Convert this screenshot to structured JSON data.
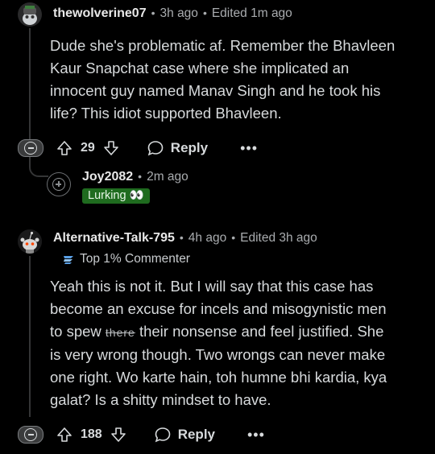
{
  "comments": [
    {
      "username": "thewolverine07",
      "time": "3h ago",
      "edited": "Edited 1m ago",
      "body": [
        "Dude she's problematic af. Remember the Bhavleen",
        "Kaur Snapchat case where she implicated an",
        "innocent guy named Manav Singh and he took his",
        "life? This idiot supported Bhavleen."
      ],
      "votes": "29",
      "reply_label": "Reply",
      "more_label": "•••"
    },
    {
      "username": "Joy2082",
      "time": "2m ago",
      "flair": "Lurking 👀"
    },
    {
      "username": "Alternative-Talk-795",
      "time": "4h ago",
      "edited": "Edited 3h ago",
      "badge": "Top 1% Commenter",
      "body_line1": "Yeah this is not it. But I will say that this case has",
      "body_line2": "become an excuse for incels and misogynistic men",
      "body_line3_pre": "to spew ",
      "body_line3_strike": "there",
      "body_line3_post": " their nonsense and feel justified. She",
      "body_line4": "is very wrong though. Two wrongs can never make",
      "body_line5": "one right. Wo karte hain, toh humne bhi kardia, kya",
      "body_line6": "galat? Is a shitty mindset to have.",
      "votes": "188",
      "reply_label": "Reply",
      "more_label": "•••"
    }
  ],
  "separator": "•"
}
